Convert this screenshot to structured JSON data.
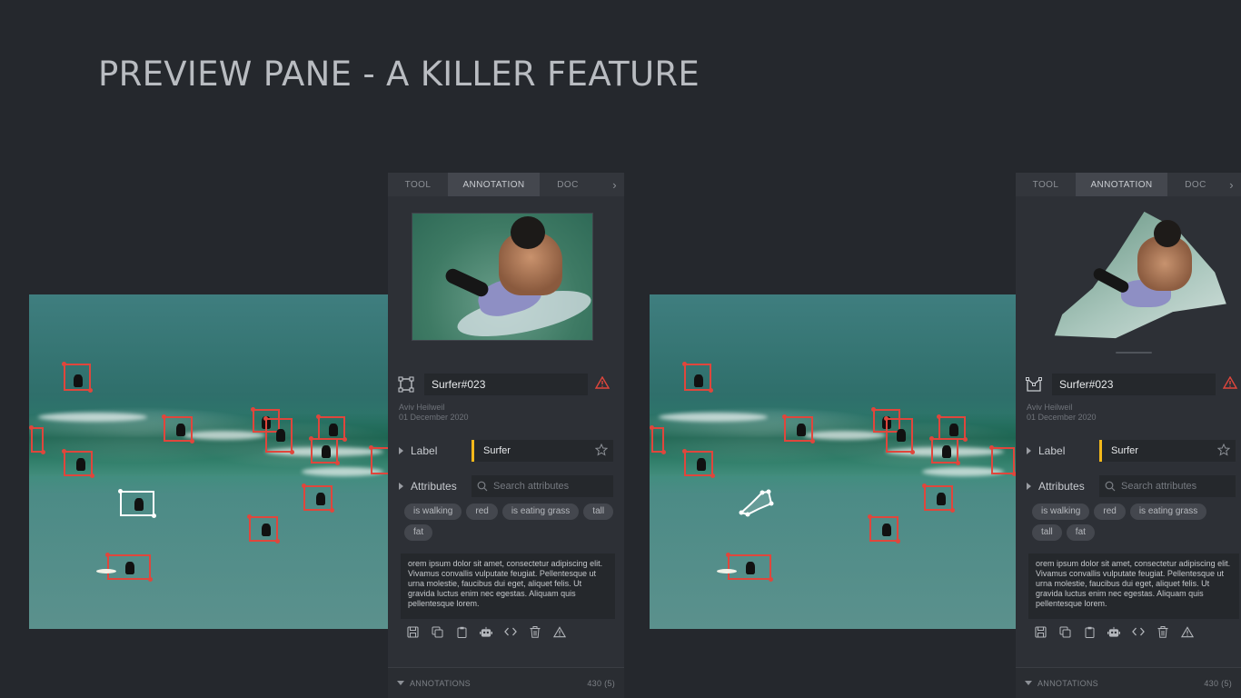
{
  "page": {
    "title": "PREVIEW PANE - A KILLER FEATURE"
  },
  "panel": {
    "tabs": [
      "TOOL",
      "ANNOTATION",
      "DOC"
    ],
    "object_name": "Surfer#023",
    "author": "Aviv Heilweil",
    "date": "01 December 2020",
    "label_title": "Label",
    "label_value": "Surfer",
    "attributes_title": "Attributes",
    "search_placeholder": "Search attributes",
    "chips": [
      "is walking",
      "red",
      "is eating grass",
      "tall",
      "fat"
    ],
    "notes": "orem ipsum dolor sit amet, consectetur adipiscing elit. Vivamus convallis vulputate feugiat. Pellentesque ut urna molestie, faucibus dui eget, aliquet felis. Ut gravida luctus enim nec egestas. Aliquam quis pellentesque lorem.",
    "footer_title": "ANNOTATIONS",
    "footer_count": "430 (5)",
    "label_accent_color": "#f3b81a",
    "warning_color": "#e0463c"
  },
  "icons": {
    "shape_left": "bounding-box-icon",
    "shape_right": "polygon-icon",
    "warning": "warning-triangle-icon",
    "star": "star-icon",
    "search": "search-icon",
    "actions": [
      "save-icon",
      "copy-icon",
      "clipboard-icon",
      "robot-icon",
      "code-icon",
      "trash-icon",
      "warning-icon"
    ]
  }
}
